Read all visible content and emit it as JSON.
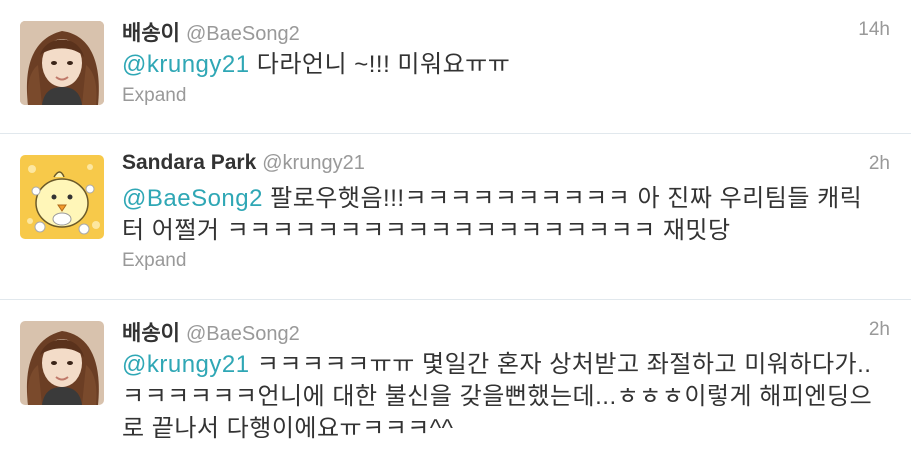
{
  "tweets": [
    {
      "fullname": "배송이",
      "username": "@BaeSong2",
      "time": "14h",
      "mention": "@krungy21",
      "text": " 다라언니 ~!!! 미워요ㅠㅠ",
      "expand": "Expand",
      "avatar": "avatar-girl-photo"
    },
    {
      "fullname": "Sandara Park",
      "username": "@krungy21",
      "time": "2h",
      "mention": "@BaeSong2",
      "text": " 팔로우햇음!!!ㅋㅋㅋㅋㅋㅋㅋㅋㅋㅋ 아 진짜 우리팀들 캐릭터 어쩔거 ㅋㅋㅋㅋㅋㅋㅋㅋㅋㅋㅋㅋㅋㅋㅋㅋㅋㅋㅋ 재밋당",
      "expand": "Expand",
      "avatar": "avatar-yellow-chick"
    },
    {
      "fullname": "배송이",
      "username": "@BaeSong2",
      "time": "2h",
      "mention": "@krungy21",
      "text": " ㅋㅋㅋㅋㅋㅠㅠ 몇일간 혼자 상처받고 좌절하고 미워하다가..ㅋㅋㅋㅋㅋㅋ언니에 대한 불신을 갖을뻔했는데...ㅎㅎㅎ이렇게 해피엔딩으로 끝나서 다행이에요ㅠㅋㅋㅋ^^",
      "avatar": "avatar-girl-photo"
    }
  ],
  "colors": {
    "link": "#2fa7b5",
    "name": "#333333",
    "meta": "#999999",
    "divider": "#e1e8ed"
  }
}
